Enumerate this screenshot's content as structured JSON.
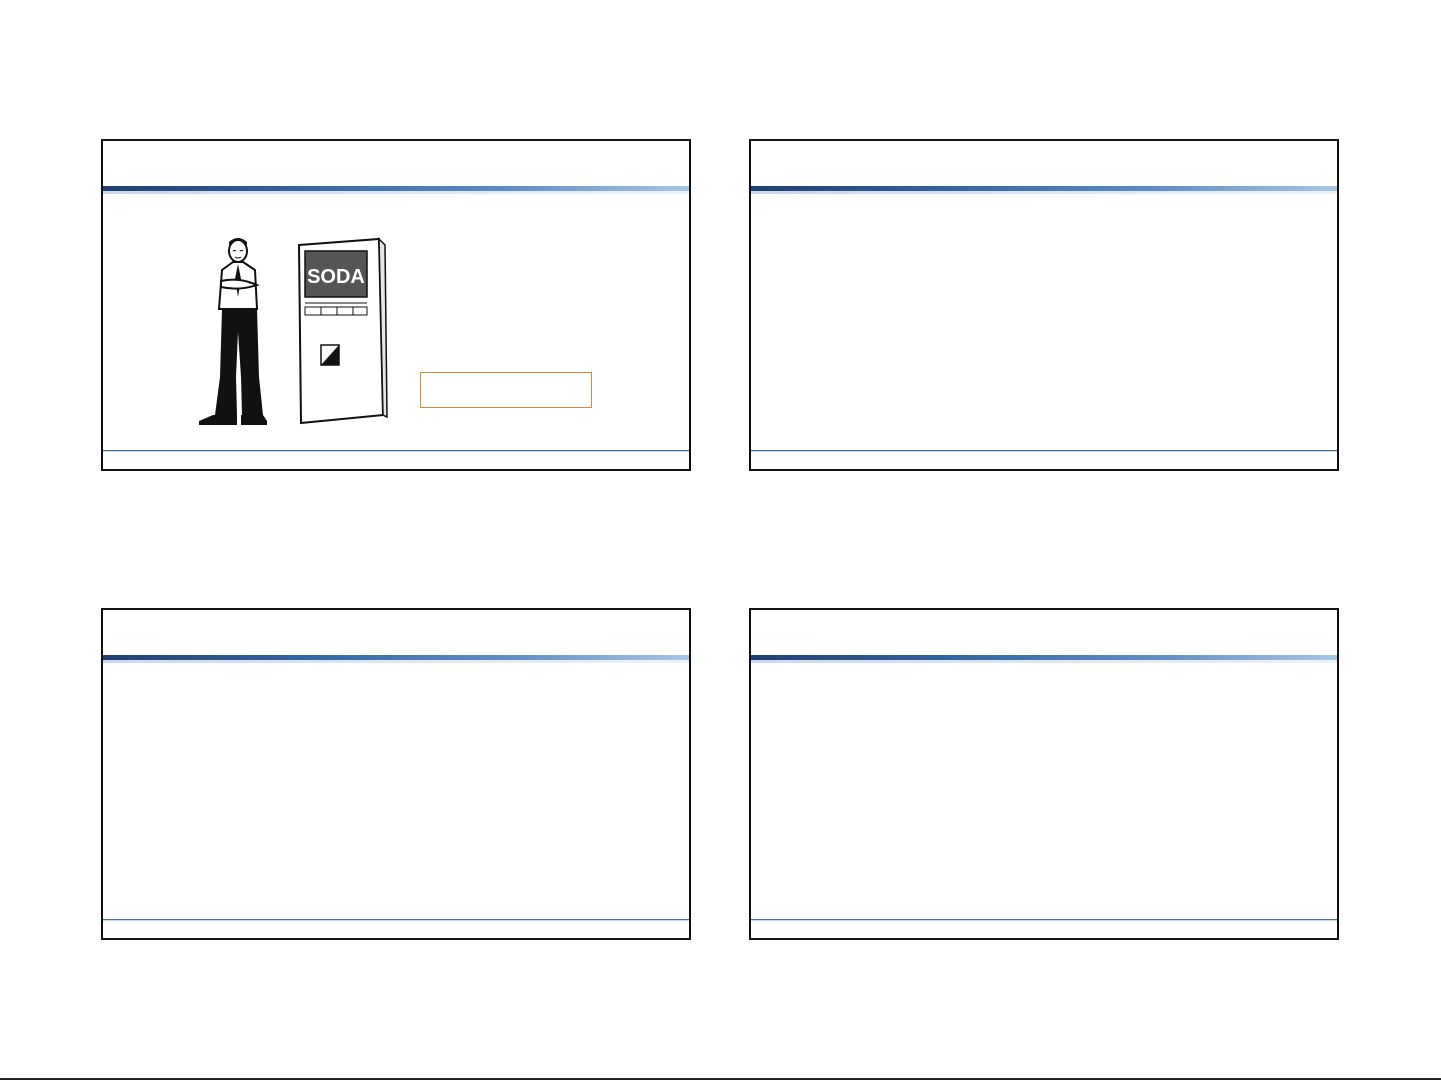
{
  "illustration": {
    "person_icon": "man-arms-crossed-icon",
    "machine_icon": "soda-machine-icon",
    "machine_sign_text": "SODA"
  },
  "colors": {
    "slide_border": "#111111",
    "title_rule_dark": "#1f3f73",
    "title_rule_light": "#a9c6e6",
    "footer_rule": "#4a6fa5",
    "answer_box_border": "#d8893a"
  }
}
